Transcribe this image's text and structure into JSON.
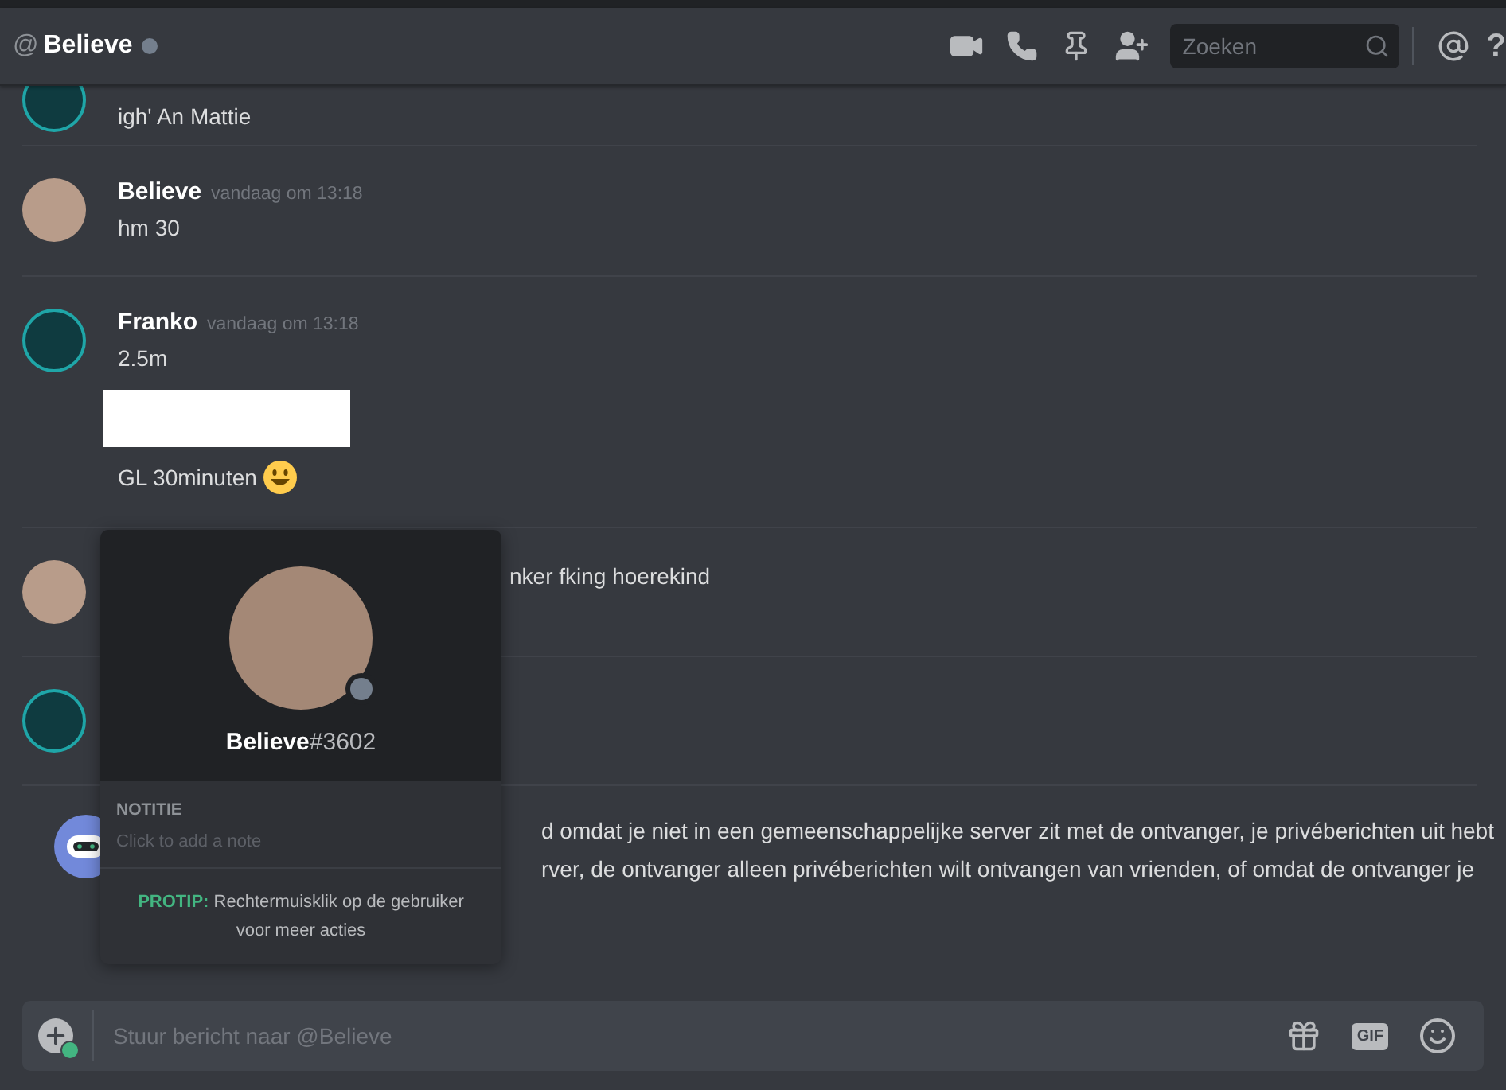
{
  "header": {
    "at": "@",
    "title": "Believe",
    "search": {
      "placeholder": "Zoeken"
    },
    "help": "?"
  },
  "messages": [
    {
      "kind": "logo",
      "lines": [
        {
          "kind": "text",
          "text": "igh' An Mattie"
        }
      ]
    },
    {
      "kind": "photo",
      "author": "Believe",
      "time": "vandaag om 13:18",
      "lines": [
        {
          "kind": "text",
          "text": "hm 30"
        }
      ]
    },
    {
      "kind": "logo",
      "author": "Franko",
      "time": "vandaag om 13:18",
      "lines": [
        {
          "kind": "text",
          "text": "2.5m"
        },
        {
          "kind": "image"
        },
        {
          "kind": "emoji",
          "text": "GL 30minuten"
        }
      ]
    },
    {
      "kind": "photo",
      "lines": [
        {
          "kind": "covered",
          "text": "nker fking hoerekind"
        }
      ]
    },
    {
      "kind": "logo"
    },
    {
      "kind": "bot",
      "lines": [
        {
          "kind": "covered",
          "text": "d omdat je niet in een gemeenschappelijke server zit met de ontvanger, je privéberichten uit hebt"
        },
        {
          "kind": "covered",
          "text": "rver, de ontvanger alleen privéberichten wilt ontvangen van vrienden, of omdat de ontvanger je"
        }
      ]
    }
  ],
  "popup": {
    "name": "Believe",
    "tag": "#3602",
    "note_label": "NOTITIE",
    "note_placeholder": "Click to add a note",
    "protip": "**PROTIP:** Rechtermuisklik op de gebruiker voor meer acties"
  },
  "composer": {
    "placeholder": "Stuur bericht naar @Believe",
    "gif": "GIF"
  }
}
